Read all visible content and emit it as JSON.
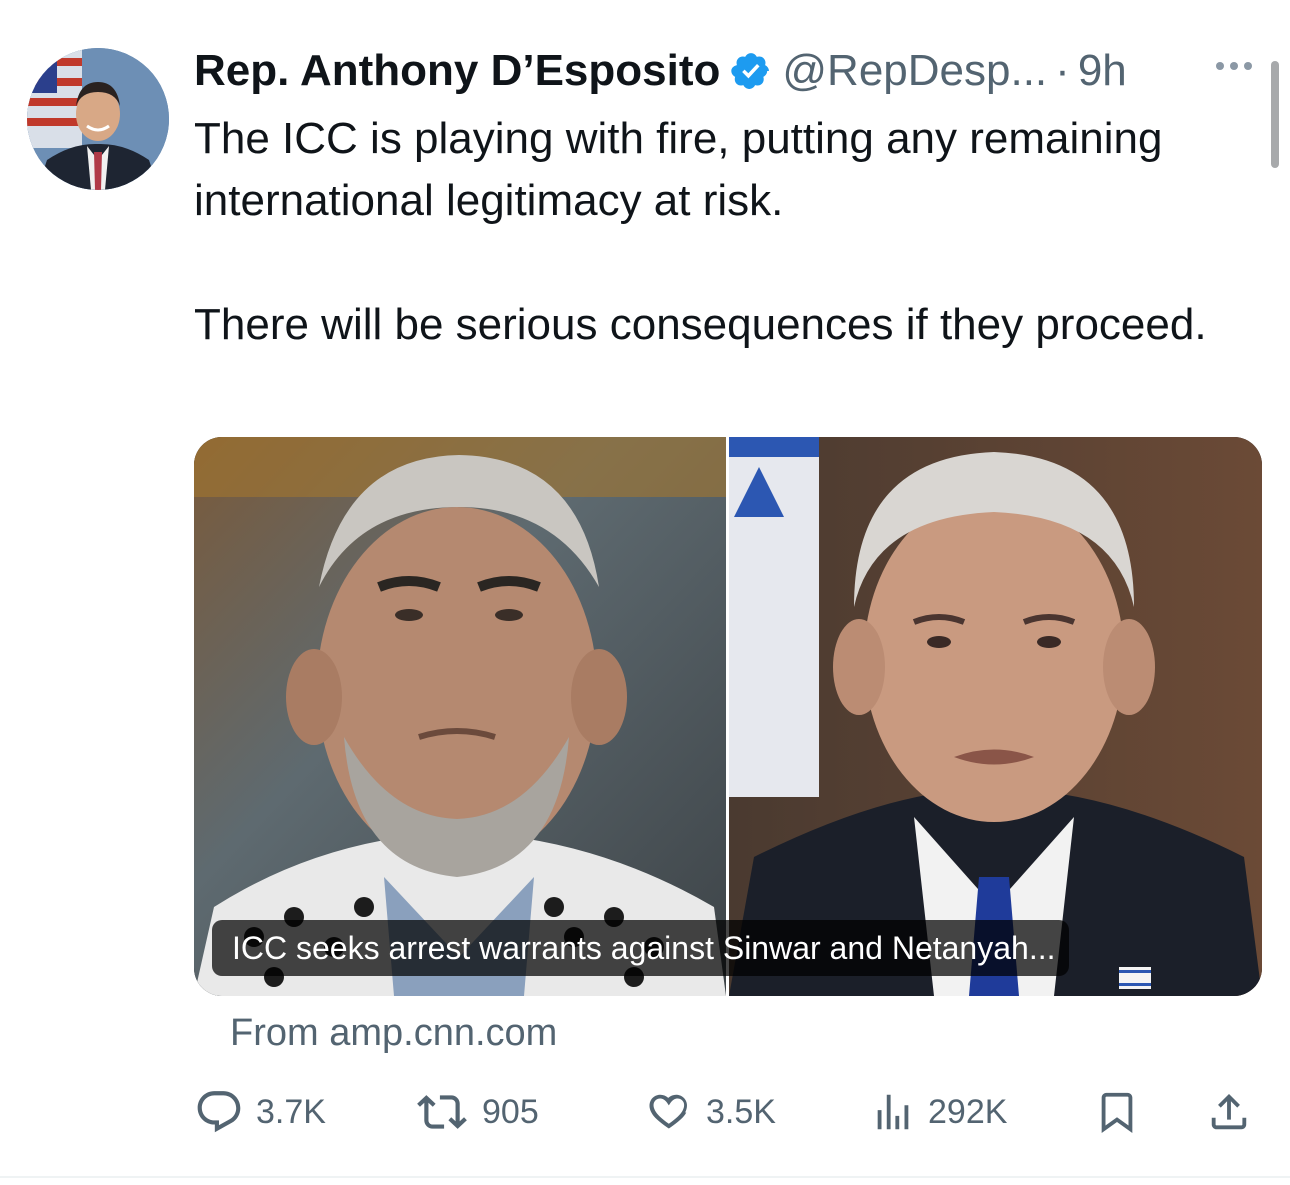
{
  "tweet": {
    "author": {
      "name": "Rep. Anthony D’Esposito",
      "handle": "@RepDesp...",
      "verified": true,
      "verified_color": "#1d9bf0"
    },
    "separator": "·",
    "time": "9h",
    "text_lines": [
      "The ICC is playing with fire, putting any remaining international legitimacy at risk.",
      "There will be serious consequences if they proceed."
    ],
    "link_card": {
      "caption": "ICC seeks arrest warrants against Sinwar and Netanyah...",
      "source": "From amp.cnn.com"
    },
    "metrics": {
      "replies": "3.7K",
      "reposts": "905",
      "likes": "3.5K",
      "views": "292K"
    },
    "icons": [
      "verified-badge-icon",
      "more-icon",
      "reply-icon",
      "repost-icon",
      "like-icon",
      "views-icon",
      "bookmark-icon",
      "share-icon"
    ]
  }
}
